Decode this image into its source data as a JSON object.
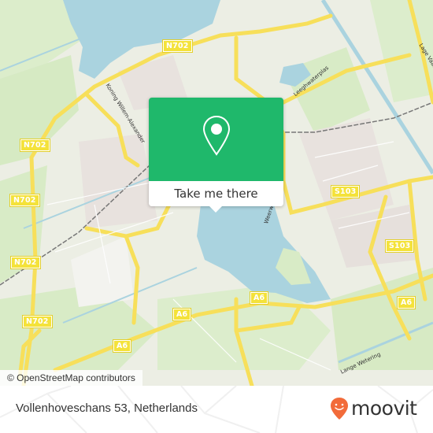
{
  "map": {
    "attribution": "© OpenStreetMap contributors",
    "road_shields": [
      {
        "id": "n702-top",
        "label": "N702"
      },
      {
        "id": "n702-left-1",
        "label": "N702"
      },
      {
        "id": "n702-left-2",
        "label": "N702"
      },
      {
        "id": "n702-left-3",
        "label": "N702"
      },
      {
        "id": "n702-left-4",
        "label": "N702"
      },
      {
        "id": "s103-1",
        "label": "S103"
      },
      {
        "id": "s103-2",
        "label": "S103"
      },
      {
        "id": "a6-1",
        "label": "A6"
      },
      {
        "id": "a6-2",
        "label": "A6"
      },
      {
        "id": "a6-3",
        "label": "A6"
      },
      {
        "id": "a6-4",
        "label": "A6"
      }
    ],
    "street_labels": [
      {
        "id": "koning",
        "label": "Koning Willem-Alexander"
      },
      {
        "id": "leeghwaterplas",
        "label": "Leeghwaterplas"
      },
      {
        "id": "lage-vaart",
        "label": "Lage Vaart"
      },
      {
        "id": "lange-wetering",
        "label": "Lange Wetering"
      },
      {
        "id": "weerwater",
        "label": "Weerwater"
      }
    ],
    "colors": {
      "water": "#aad3df",
      "park": "#d8ecc6",
      "road": "#f7df5a",
      "popup": "#1fb86b",
      "brand": "#f26b3a"
    }
  },
  "popup": {
    "button_label": "Take me there",
    "icon": "map-pin-icon"
  },
  "footer": {
    "address": "Vollenhoveschans 53, Netherlands",
    "brand": "moovit"
  }
}
